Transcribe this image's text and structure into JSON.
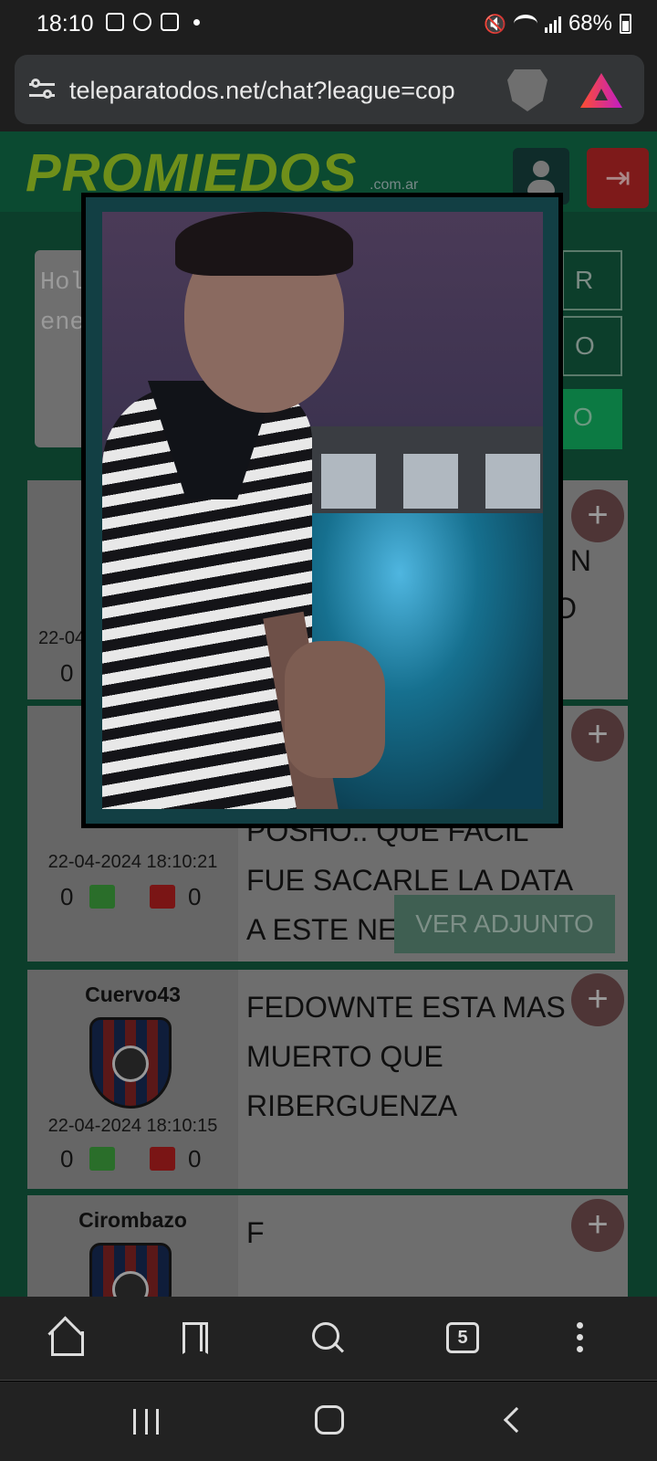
{
  "status": {
    "time": "18:10",
    "battery": "68%"
  },
  "browser": {
    "url": "teleparatodos.net/chat?league=cop",
    "tabs_count": "5"
  },
  "site": {
    "logo": "PROMIEDOS",
    "logo_sub": ".com.ar",
    "compose_placeholder_line1": "Hol",
    "compose_placeholder_line2": "ene",
    "side_btn_1": "R",
    "side_btn_2": "O",
    "side_btn_3": "O"
  },
  "posts": [
    {
      "user": "",
      "date": "22-04",
      "likes": "0",
      "dislikes": "",
      "message_fragment_1": "N",
      "message_fragment_2": "O"
    },
    {
      "user": "",
      "date": "22-04-2024 18:10:21",
      "likes": "0",
      "dislikes": "0",
      "message": "POSHO.. QUE FACIL FUE SACARLE LA DATA A ESTE NENAZO.",
      "attachment_label": "VER ADJUNTO"
    },
    {
      "user": "Cuervo43",
      "date": "22-04-2024 18:10:15",
      "likes": "0",
      "dislikes": "0",
      "message": "FEDOWNTE ESTA MAS MUERTO QUE RIBERGUENZA"
    },
    {
      "user": "Cirombazo",
      "message": "F"
    }
  ],
  "icons": {
    "plus": "+",
    "logout": "⇥"
  }
}
